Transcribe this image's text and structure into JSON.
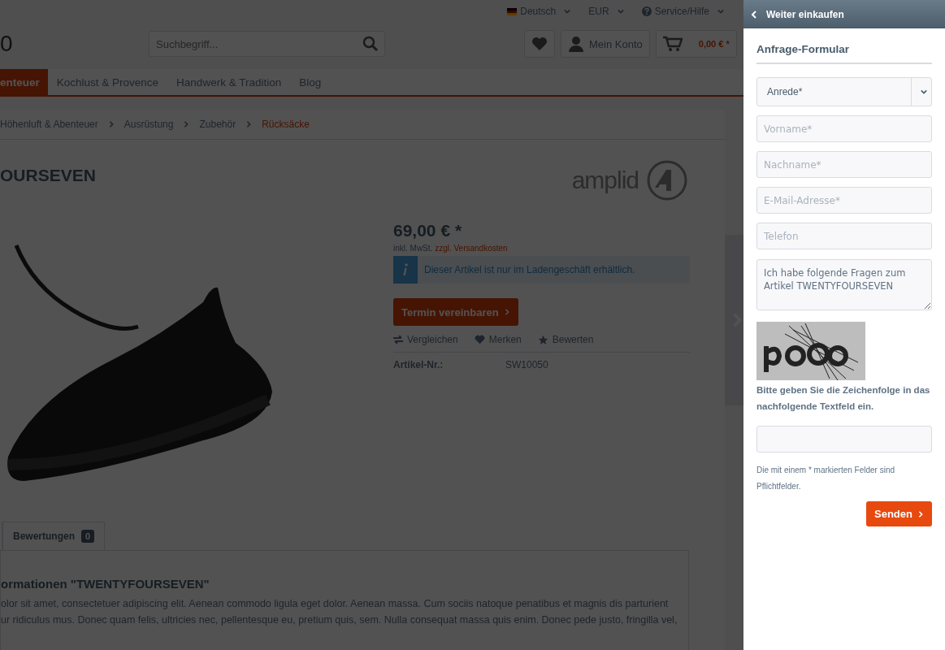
{
  "top_bar": {
    "language": "Deutsch",
    "currency": "EUR",
    "service": "Service/Hilfe"
  },
  "header": {
    "logo_text": "0",
    "search": {
      "placeholder": "Suchbegriff..."
    },
    "account": "Mein Konto",
    "cart_total": "0,00 € *"
  },
  "nav": [
    {
      "label": "enteuer",
      "selected": true
    },
    {
      "label": "Kochlust & Provence",
      "selected": false
    },
    {
      "label": "Handwerk & Tradition",
      "selected": false
    },
    {
      "label": "Blog",
      "selected": false
    }
  ],
  "breadcrumb": [
    {
      "label": "Höhenluft & Abenteuer",
      "selected": false
    },
    {
      "label": "Ausrüstung",
      "selected": false
    },
    {
      "label": "Zubehör",
      "selected": false
    },
    {
      "label": "Rücksäcke",
      "selected": true
    }
  ],
  "product": {
    "title": "OURSEVEN",
    "brand_logo": "amplid",
    "price": "69,00 € *",
    "tax_note": "inkl. MwSt.",
    "shipping_link": "zzgl. Versandkosten",
    "info": "Dieser Artikel ist nur im Ladengeschäft erhältlich.",
    "appointment_button": "Termin vereinbaren",
    "actions": [
      {
        "kind": "compare",
        "label": "Vergleichen"
      },
      {
        "kind": "wishlist",
        "label": "Merken"
      },
      {
        "kind": "rate",
        "label": "Bewerten"
      }
    ],
    "article_label": "Artikel-Nr.:",
    "article_number": "SW10050"
  },
  "tabs": [
    {
      "label": "Bewertungen",
      "count": "0",
      "selected": true
    }
  ],
  "description": {
    "heading": "ormationen \"TWENTYFOURSEVEN\"",
    "lines": [
      "olor sit amet, consectetuer adipiscing elit. Aenean commodo ligula eget dolor. Aenean massa. Cum sociis natoque penatibus et magnis dis parturient",
      "ur ridiculus mus. Donec quam felis, ultricies nec, pellentesque eu, pretium quis, sem. Nulla consequat massa quis enim. Donec pede justo, fringilla vel,"
    ]
  },
  "panel": {
    "back_link": "Weiter einkaufen",
    "title": "Anfrage-Formular",
    "salutation": "Anrede*",
    "fields": [
      {
        "placeholder": "Vorname*"
      },
      {
        "placeholder": "Nachname*"
      },
      {
        "placeholder": "E-Mail-Adresse*"
      },
      {
        "placeholder": "Telefon"
      }
    ],
    "message": "Ich habe folgende Fragen zum Artikel TWENTYFOURSEVEN",
    "captcha_hint": "Bitte geben Sie die Zeichenfolge in das nachfolgende Textfeld ein.",
    "required_note": "Die mit einem * markierten Felder sind Pflichtfelder.",
    "submit": "Senden"
  }
}
